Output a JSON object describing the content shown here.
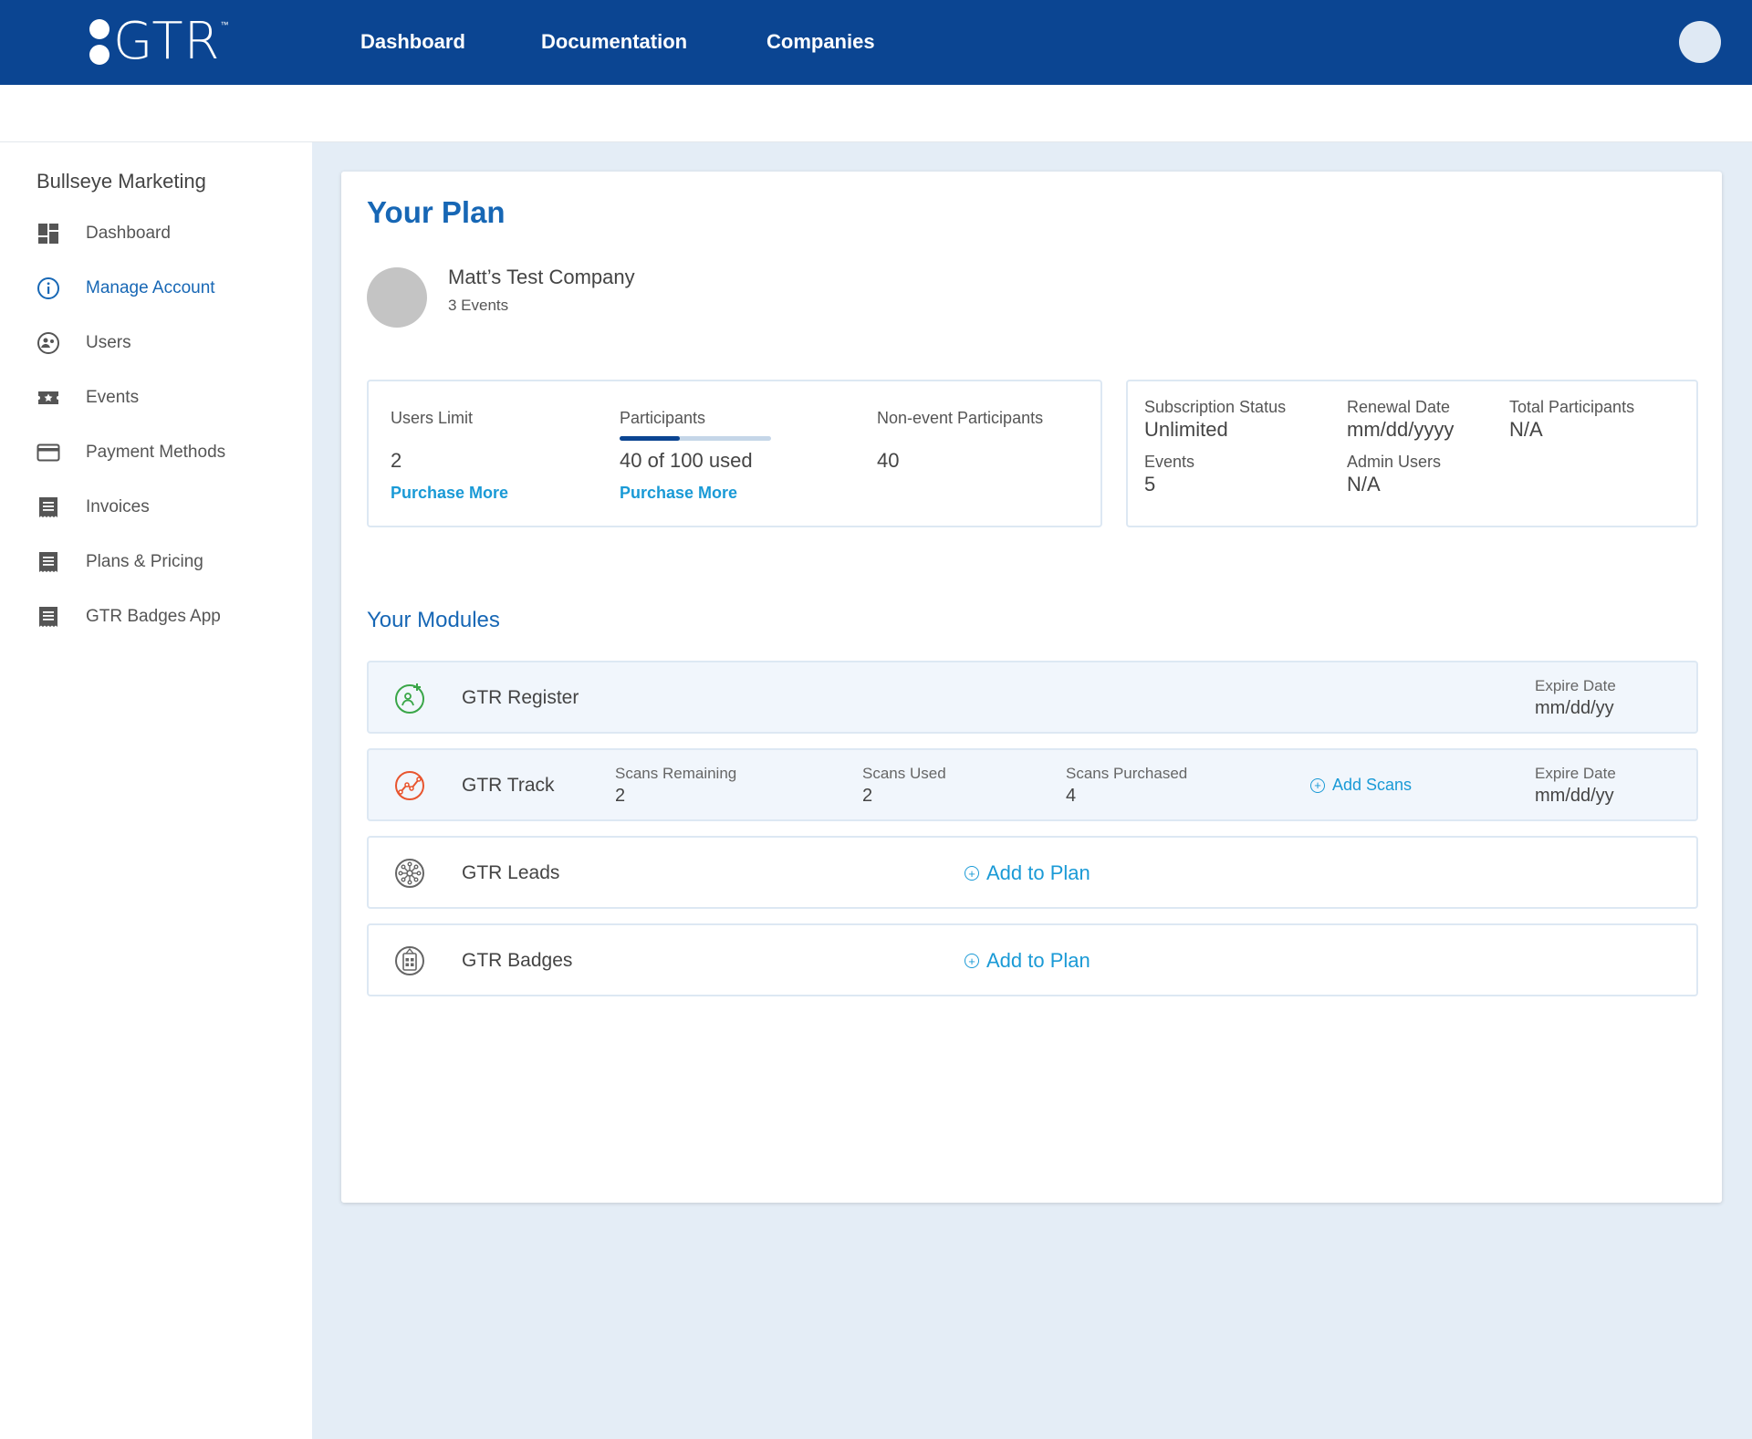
{
  "header": {
    "logo_text": "GTR",
    "logo_tm": "™",
    "nav": [
      "Dashboard",
      "Documentation",
      "Companies"
    ]
  },
  "sidebar": {
    "org_name": "Bullseye Marketing",
    "items": [
      {
        "label": "Dashboard",
        "icon": "dashboard-icon"
      },
      {
        "label": "Manage Account",
        "icon": "info-icon",
        "active": true
      },
      {
        "label": "Users",
        "icon": "users-icon"
      },
      {
        "label": "Events",
        "icon": "events-icon"
      },
      {
        "label": "Payment Methods",
        "icon": "credit-card-icon"
      },
      {
        "label": "Invoices",
        "icon": "receipt-icon"
      },
      {
        "label": "Plans & Pricing",
        "icon": "receipt-icon"
      },
      {
        "label": "GTR Badges App",
        "icon": "receipt-icon"
      }
    ]
  },
  "plan": {
    "title": "Your Plan",
    "company_name": "Matt’s Test Company",
    "company_events": "3 Events",
    "usage": {
      "users_limit_label": "Users Limit",
      "users_limit_value": "2",
      "users_purchase": "Purchase More",
      "participants_label": "Participants",
      "participants_value": "40 of 100 used",
      "participants_progress": 0.4,
      "participants_purchase": "Purchase More",
      "non_event_label": "Non-event Participants",
      "non_event_value": "40"
    },
    "subscription": {
      "status_label": "Subscription Status",
      "status_value": "Unlimited",
      "renewal_label": "Renewal Date",
      "renewal_value": "mm/dd/yyyy",
      "total_participants_label": "Total Participants",
      "total_participants_value": "N/A",
      "events_label": "Events",
      "events_value": "5",
      "admin_users_label": "Admin Users",
      "admin_users_value": "N/A"
    }
  },
  "modules": {
    "title": "Your Modules",
    "register": {
      "name": "GTR Register",
      "expire_label": "Expire Date",
      "expire_value": "mm/dd/yy"
    },
    "track": {
      "name": "GTR Track",
      "scans_remaining_label": "Scans Remaining",
      "scans_remaining_value": "2",
      "scans_used_label": "Scans Used",
      "scans_used_value": "2",
      "scans_purchased_label": "Scans Purchased",
      "scans_purchased_value": "4",
      "add_scans": "Add Scans",
      "expire_label": "Expire Date",
      "expire_value": "mm/dd/yy"
    },
    "leads": {
      "name": "GTR Leads",
      "add": "Add to Plan"
    },
    "badges": {
      "name": "GTR Badges",
      "add": "Add to Plan"
    }
  },
  "colors": {
    "nav_bg": "#0b4592",
    "accent": "#1767b5",
    "link": "#1a9ad6",
    "register_icon": "#3aa648",
    "track_icon": "#e8552f"
  }
}
